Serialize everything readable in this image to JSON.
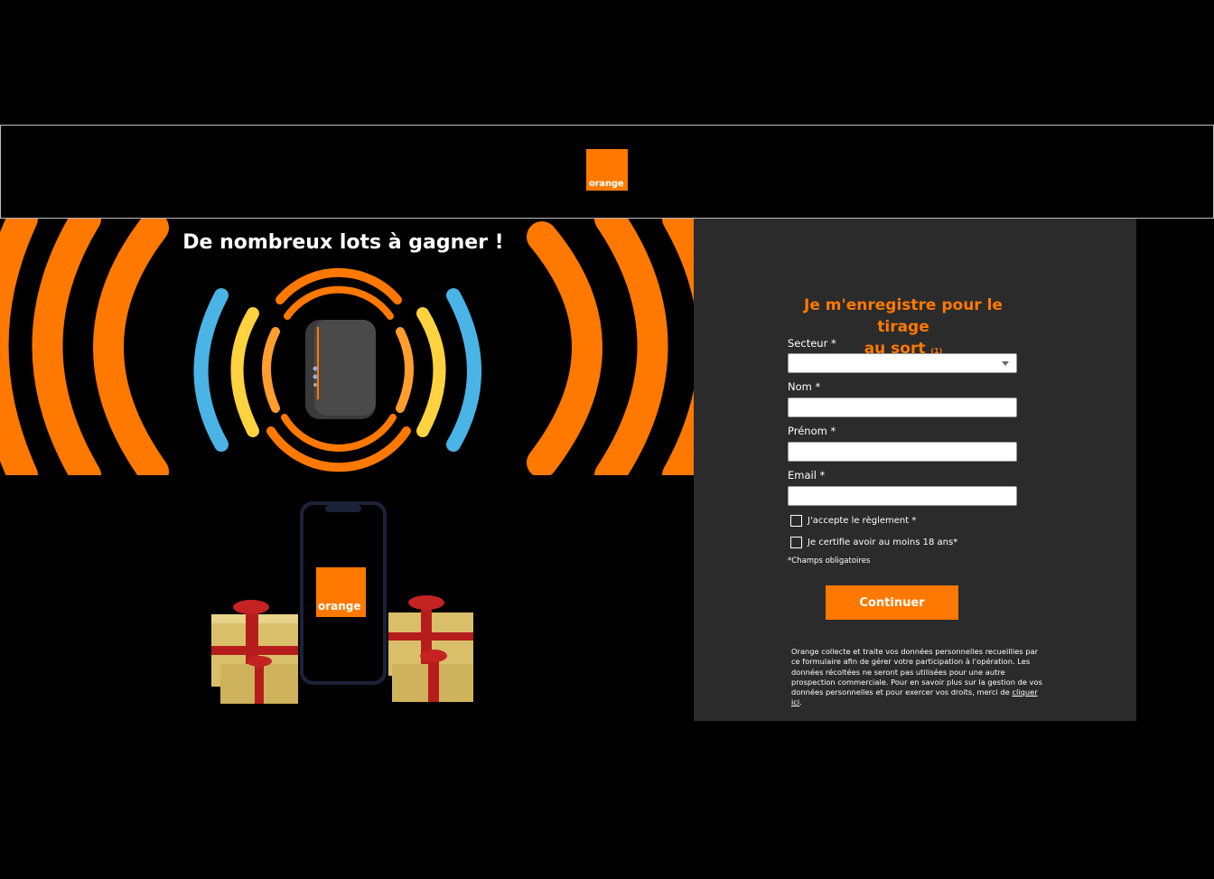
{
  "header": {
    "logo_text": "orange"
  },
  "banner": {
    "title": "De nombreux lots à gagner !"
  },
  "prizes": {
    "phone_logo_text": "orange"
  },
  "form": {
    "title_line1": "Je m'enregistre pour le tirage",
    "title_line2": "au sort",
    "title_note": "(1)",
    "fields": {
      "secteur_label": "Secteur *",
      "nom_label": "Nom *",
      "prenom_label": "Prénom *",
      "email_label": "Email *"
    },
    "checkbox_reglement": "J'accepte le règlement *",
    "checkbox_age": "Je certifie avoir au moins 18 ans*",
    "required_note": "*Champs obligatoires",
    "continue_label": "Continuer",
    "legal_text": "Orange collecte et traite vos données personnelles recueillies par ce formulaire afin de gérer votre participation à l'opération. Les données récoltées ne seront pas utilisées pour une autre prospection commerciale. Pour en savoir plus sur la gestion de vos données personnelles et pour exercer vos droits, merci de ",
    "legal_link": "cliquer ici",
    "legal_end": "."
  },
  "colors": {
    "brand_orange": "#ff7900",
    "panel_bg": "#2b2b2b",
    "wave_yellow": "#ffd23f",
    "wave_blue": "#4bb4e6"
  }
}
